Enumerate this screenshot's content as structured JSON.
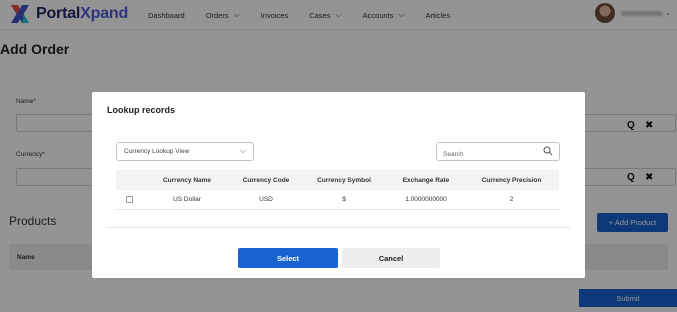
{
  "brand": {
    "name_part1": "Portal",
    "name_part2": "Xpand",
    "icon": "portalxpand-logo-icon"
  },
  "nav": {
    "items": [
      {
        "label": "Dashboard",
        "has_dropdown": false
      },
      {
        "label": "Orders",
        "has_dropdown": true
      },
      {
        "label": "Invoices",
        "has_dropdown": false
      },
      {
        "label": "Cases",
        "has_dropdown": true
      },
      {
        "label": "Accounts",
        "has_dropdown": true
      },
      {
        "label": "Articles",
        "has_dropdown": false
      }
    ],
    "dropdown_icon": "chevron-down-icon"
  },
  "user": {
    "avatar_icon": "user-avatar"
  },
  "page": {
    "title": "Add Order",
    "fields": [
      {
        "label": "Name*"
      },
      {
        "label": "Currency*"
      }
    ],
    "lookup_search_icon": "search-icon",
    "lookup_clear_icon": "close-icon",
    "lookup_search_glyph": "Q",
    "lookup_clear_glyph": "✖",
    "products_title": "Products",
    "add_product_label": "+ Add Product",
    "products_table_header": "Name",
    "submit_label": "Submit"
  },
  "modal": {
    "title": "Lookup records",
    "view_select": {
      "value": "Currency Lookup View",
      "icon": "chevron-down-icon"
    },
    "search": {
      "placeholder": "Search",
      "icon": "search-icon"
    },
    "columns": [
      "Currency Name",
      "Currency Code",
      "Currency Symbol",
      "Exchange Rate",
      "Currency Precision"
    ],
    "rows": [
      {
        "selected": false,
        "cells": [
          "US Dollar",
          "USD",
          "$",
          "1.0000000000",
          "2"
        ]
      }
    ],
    "select_label": "Select",
    "cancel_label": "Cancel"
  },
  "colors": {
    "primary": "#1763d1",
    "brand_dark": "#1e2a6b",
    "brand_accent": "#4a5bd6",
    "overlay": "rgba(0,0,0,0.42)"
  }
}
